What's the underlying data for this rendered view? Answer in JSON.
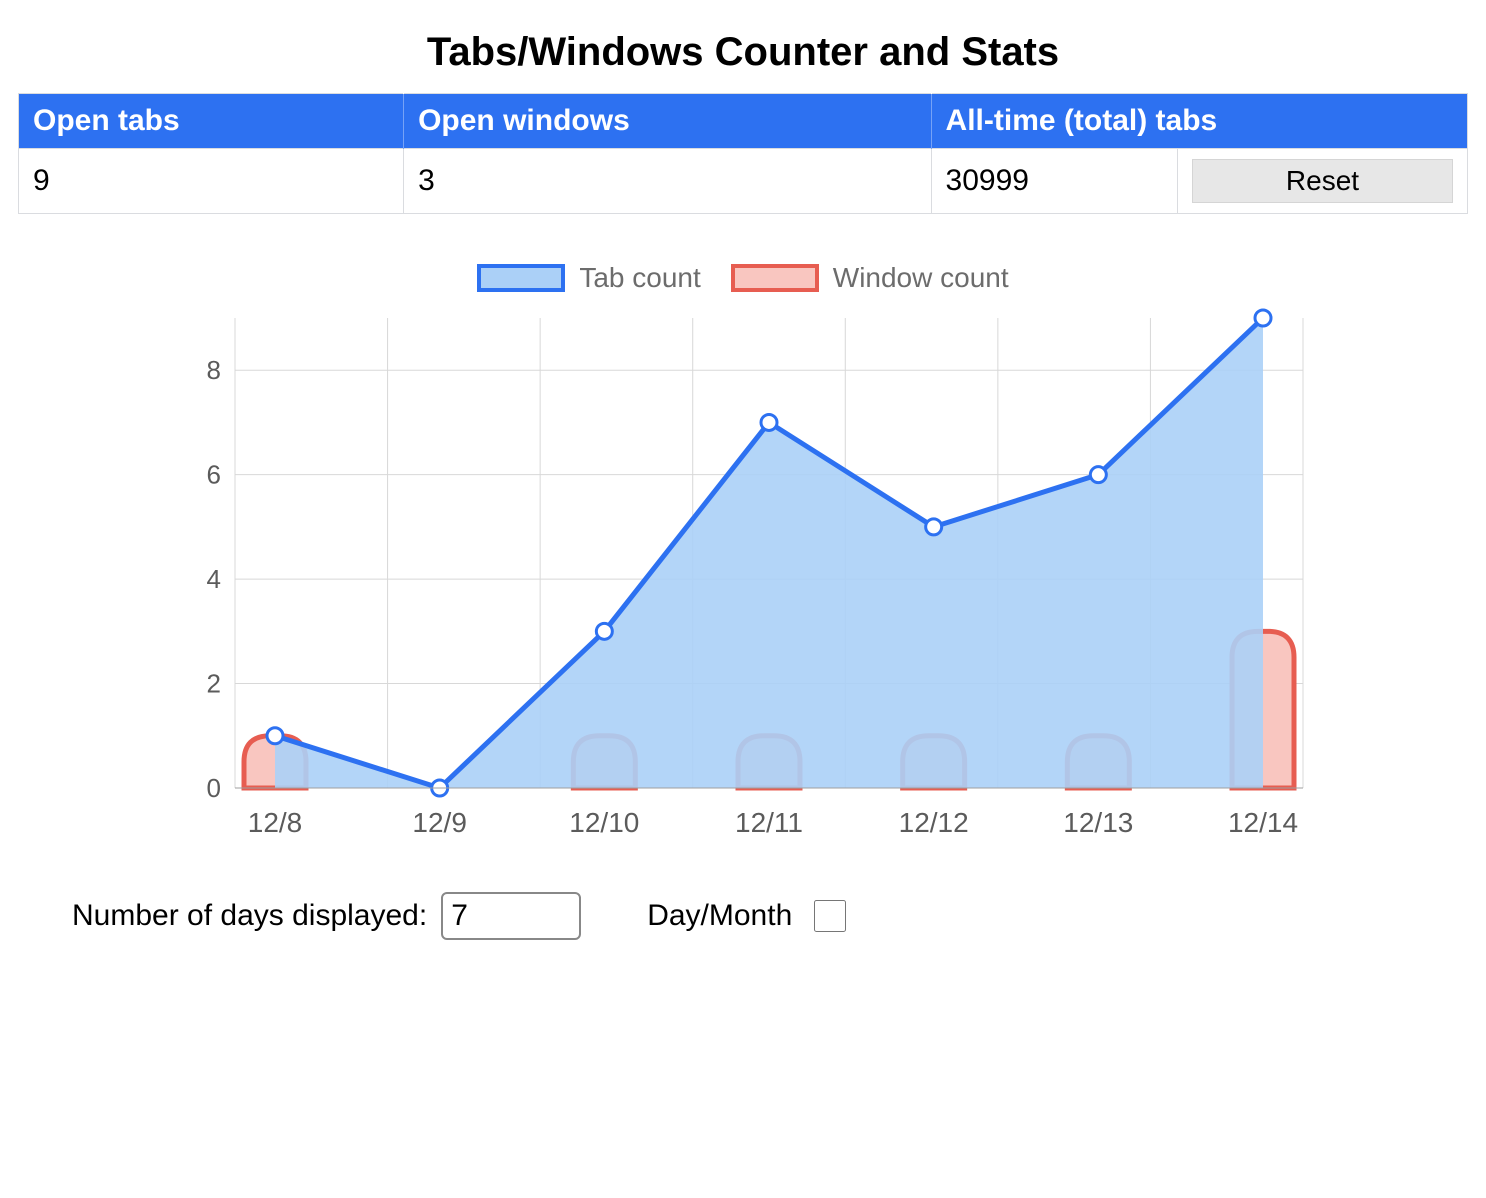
{
  "title": "Tabs/Windows Counter and Stats",
  "table": {
    "headers": {
      "open_tabs": "Open tabs",
      "open_windows": "Open windows",
      "all_time_tabs": "All-time (total) tabs"
    },
    "values": {
      "open_tabs": "9",
      "open_windows": "3",
      "all_time_tabs": "30999"
    },
    "reset_label": "Reset"
  },
  "legend": {
    "tab": "Tab count",
    "window": "Window count"
  },
  "controls": {
    "days_label": "Number of days displayed:",
    "days_value": "7",
    "day_month_label": "Day/Month",
    "day_month_checked": false
  },
  "colors": {
    "primary_blue": "#2d71f1",
    "area_blue": "#abd0f7",
    "primary_red": "#e75d51",
    "area_red": "#f9c6c0"
  },
  "chart_data": {
    "type": "area",
    "categories": [
      "12/8",
      "12/9",
      "12/10",
      "12/11",
      "12/12",
      "12/13",
      "12/14"
    ],
    "series": [
      {
        "name": "Tab count",
        "style": "line-area",
        "values": [
          1,
          0,
          3,
          7,
          5,
          6,
          9
        ]
      },
      {
        "name": "Window count",
        "style": "bar",
        "values": [
          1,
          0,
          1,
          1,
          1,
          1,
          3
        ]
      }
    ],
    "ylim": [
      0,
      9
    ],
    "yticks": [
      0,
      2,
      4,
      6,
      8
    ],
    "xlabel": "",
    "ylabel": "",
    "title": ""
  }
}
